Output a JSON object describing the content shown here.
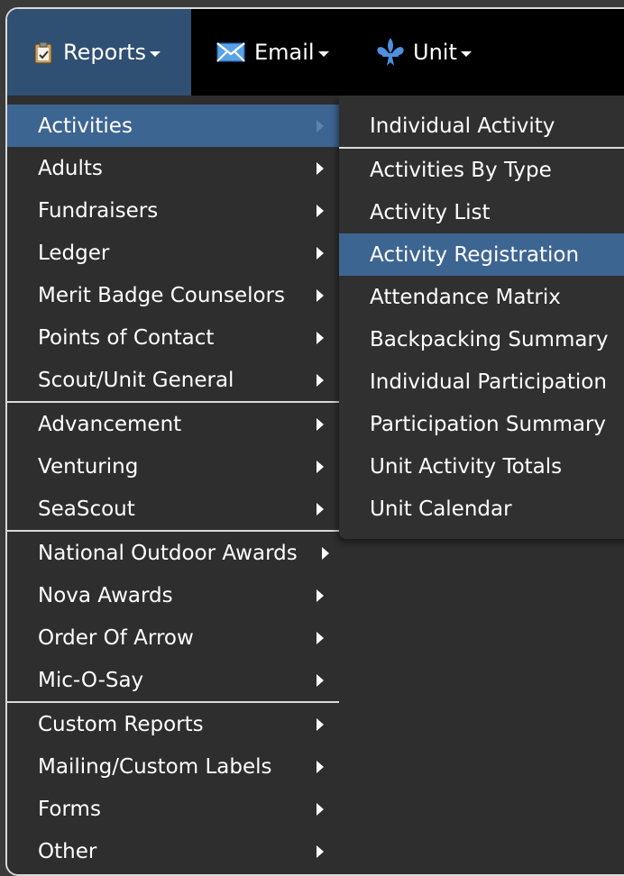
{
  "navbar": {
    "reports": {
      "label": "Reports",
      "icon": "clipboard-icon"
    },
    "email": {
      "label": "Email",
      "icon": "envelope-icon"
    },
    "unit": {
      "label": "Unit",
      "icon": "fleur-de-lis-icon"
    }
  },
  "reports_menu": {
    "group1": [
      "Activities",
      "Adults",
      "Fundraisers",
      "Ledger",
      "Merit Badge Counselors",
      "Points of Contact",
      "Scout/Unit General"
    ],
    "group2": [
      "Advancement",
      "Venturing",
      "SeaScout"
    ],
    "group3": [
      "National Outdoor Awards",
      "Nova Awards",
      "Order Of Arrow",
      "Mic-O-Say"
    ],
    "group4": [
      "Custom Reports",
      "Mailing/Custom Labels",
      "Forms",
      "Other"
    ]
  },
  "activities_submenu": {
    "first": "Individual Activity",
    "rest": [
      "Activities By Type",
      "Activity List",
      "Activity Registration",
      "Attendance Matrix",
      "Backpacking Summary",
      "Individual Participation",
      "Participation Summary",
      "Unit Activity Totals",
      "Unit Calendar"
    ]
  },
  "colors": {
    "navbar_bg": "#000000",
    "active_nav_bg": "#2f4f73",
    "menu_bg": "#2e2e2e",
    "highlight_bg": "#3d6592",
    "separator": "#d9d9d9"
  }
}
